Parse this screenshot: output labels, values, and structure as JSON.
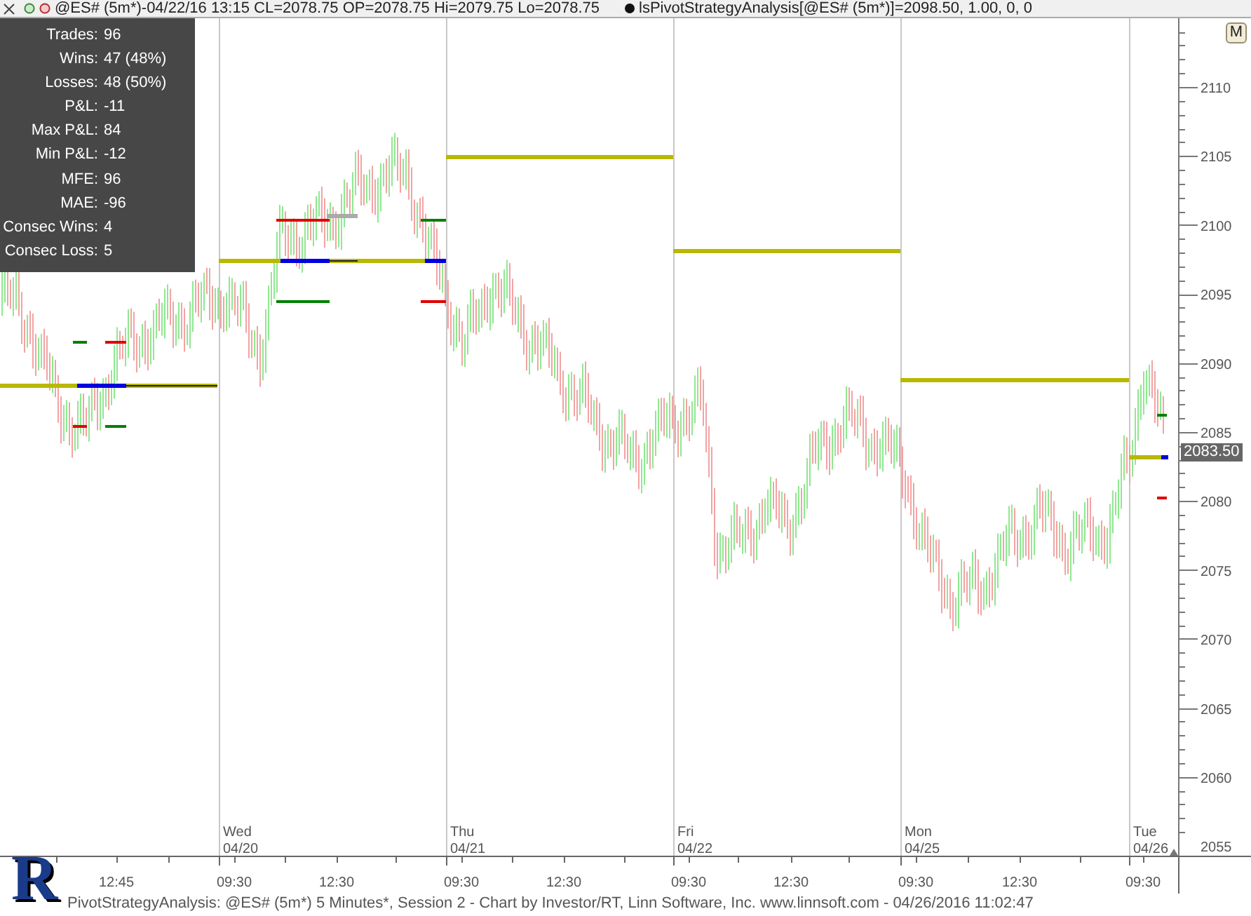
{
  "header": {
    "symbol_info": "@ES# (5m*)-04/22/16 13:15 CL=2078.75 OP=2078.75 Hi=2079.75 Lo=2078.75",
    "study_info": "lsPivotStrategyAnalysis[@ES# (5m*)]=2098.50, 1.00, 0, 0"
  },
  "stats": [
    {
      "label": "Trades:",
      "value": "96"
    },
    {
      "label": "Wins:",
      "value": "47 (48%)"
    },
    {
      "label": "Losses:",
      "value": "48 (50%)"
    },
    {
      "label": "P&L:",
      "value": "-11"
    },
    {
      "label": "Max P&L:",
      "value": "84"
    },
    {
      "label": "Min P&L:",
      "value": "-12"
    },
    {
      "label": "MFE:",
      "value": "96"
    },
    {
      "label": "MAE:",
      "value": "-96"
    },
    {
      "label": "Consec Wins:",
      "value": "4"
    },
    {
      "label": "Consec Loss:",
      "value": "5"
    }
  ],
  "chart": {
    "m_button": "M",
    "last_price": "2083.50",
    "day_labels": [
      {
        "day": "Wed",
        "date": "04/20"
      },
      {
        "day": "Thu",
        "date": "04/21"
      },
      {
        "day": "Fri",
        "date": "04/22"
      },
      {
        "day": "Mon",
        "date": "04/25"
      },
      {
        "day": "Tue",
        "date": "04/26"
      }
    ],
    "price_axis": [
      "2110",
      "2105",
      "2100",
      "2095",
      "2090",
      "2085",
      "2080",
      "2075",
      "2070",
      "2065",
      "2060",
      "2055"
    ],
    "time_axis": [
      "12:45",
      "09:30",
      "12:30",
      "09:30",
      "12:30",
      "09:30",
      "12:30",
      "09:30",
      "12:30",
      "09:30"
    ]
  },
  "status_bar": {
    "logo": "R",
    "text": "PivotStrategyAnalysis: @ES# (5m*) 5 Minutes*, Session 2 - Chart by Investor/RT, Linn Software, Inc. www.linnsoft.com - 04/26/2016 11:02:47"
  }
}
